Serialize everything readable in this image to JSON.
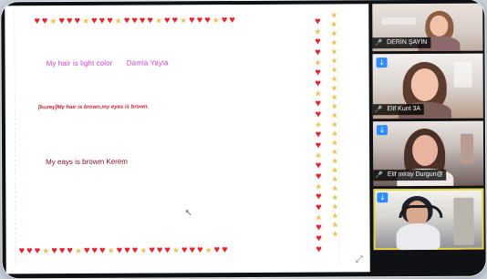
{
  "whiteboard": {
    "notes": [
      {
        "text": "My hair is light color",
        "author": "Damla Yayla"
      },
      {
        "text": "[kuzey]My hair is brown,my eyes is brown."
      },
      {
        "text": "My eays is browm Kerem"
      }
    ],
    "decor": {
      "heart": "♥",
      "star": "★",
      "cursor": "↖",
      "expand": "⤢"
    }
  },
  "participants": [
    {
      "name": "DERİN ŞAYIN",
      "muted": true,
      "indicator": ""
    },
    {
      "name": "Elif Kunt 3A",
      "muted": true,
      "indicator": "↓"
    },
    {
      "name": "Elif miray Durgun@",
      "muted": true,
      "indicator": "↓"
    },
    {
      "name": "",
      "muted": false,
      "indicator": "↓"
    }
  ],
  "icons": {
    "mic_muted": "🎤",
    "raise_hand": "↓"
  },
  "colors": {
    "heart": "#ef1f2b",
    "star": "#e9c451",
    "note_pink": "#d142d4",
    "note_red": "#d0202e",
    "note_maroon": "#7e0f26",
    "zoom_blue": "#2d8cff",
    "active_speaker": "#e5d43d"
  }
}
